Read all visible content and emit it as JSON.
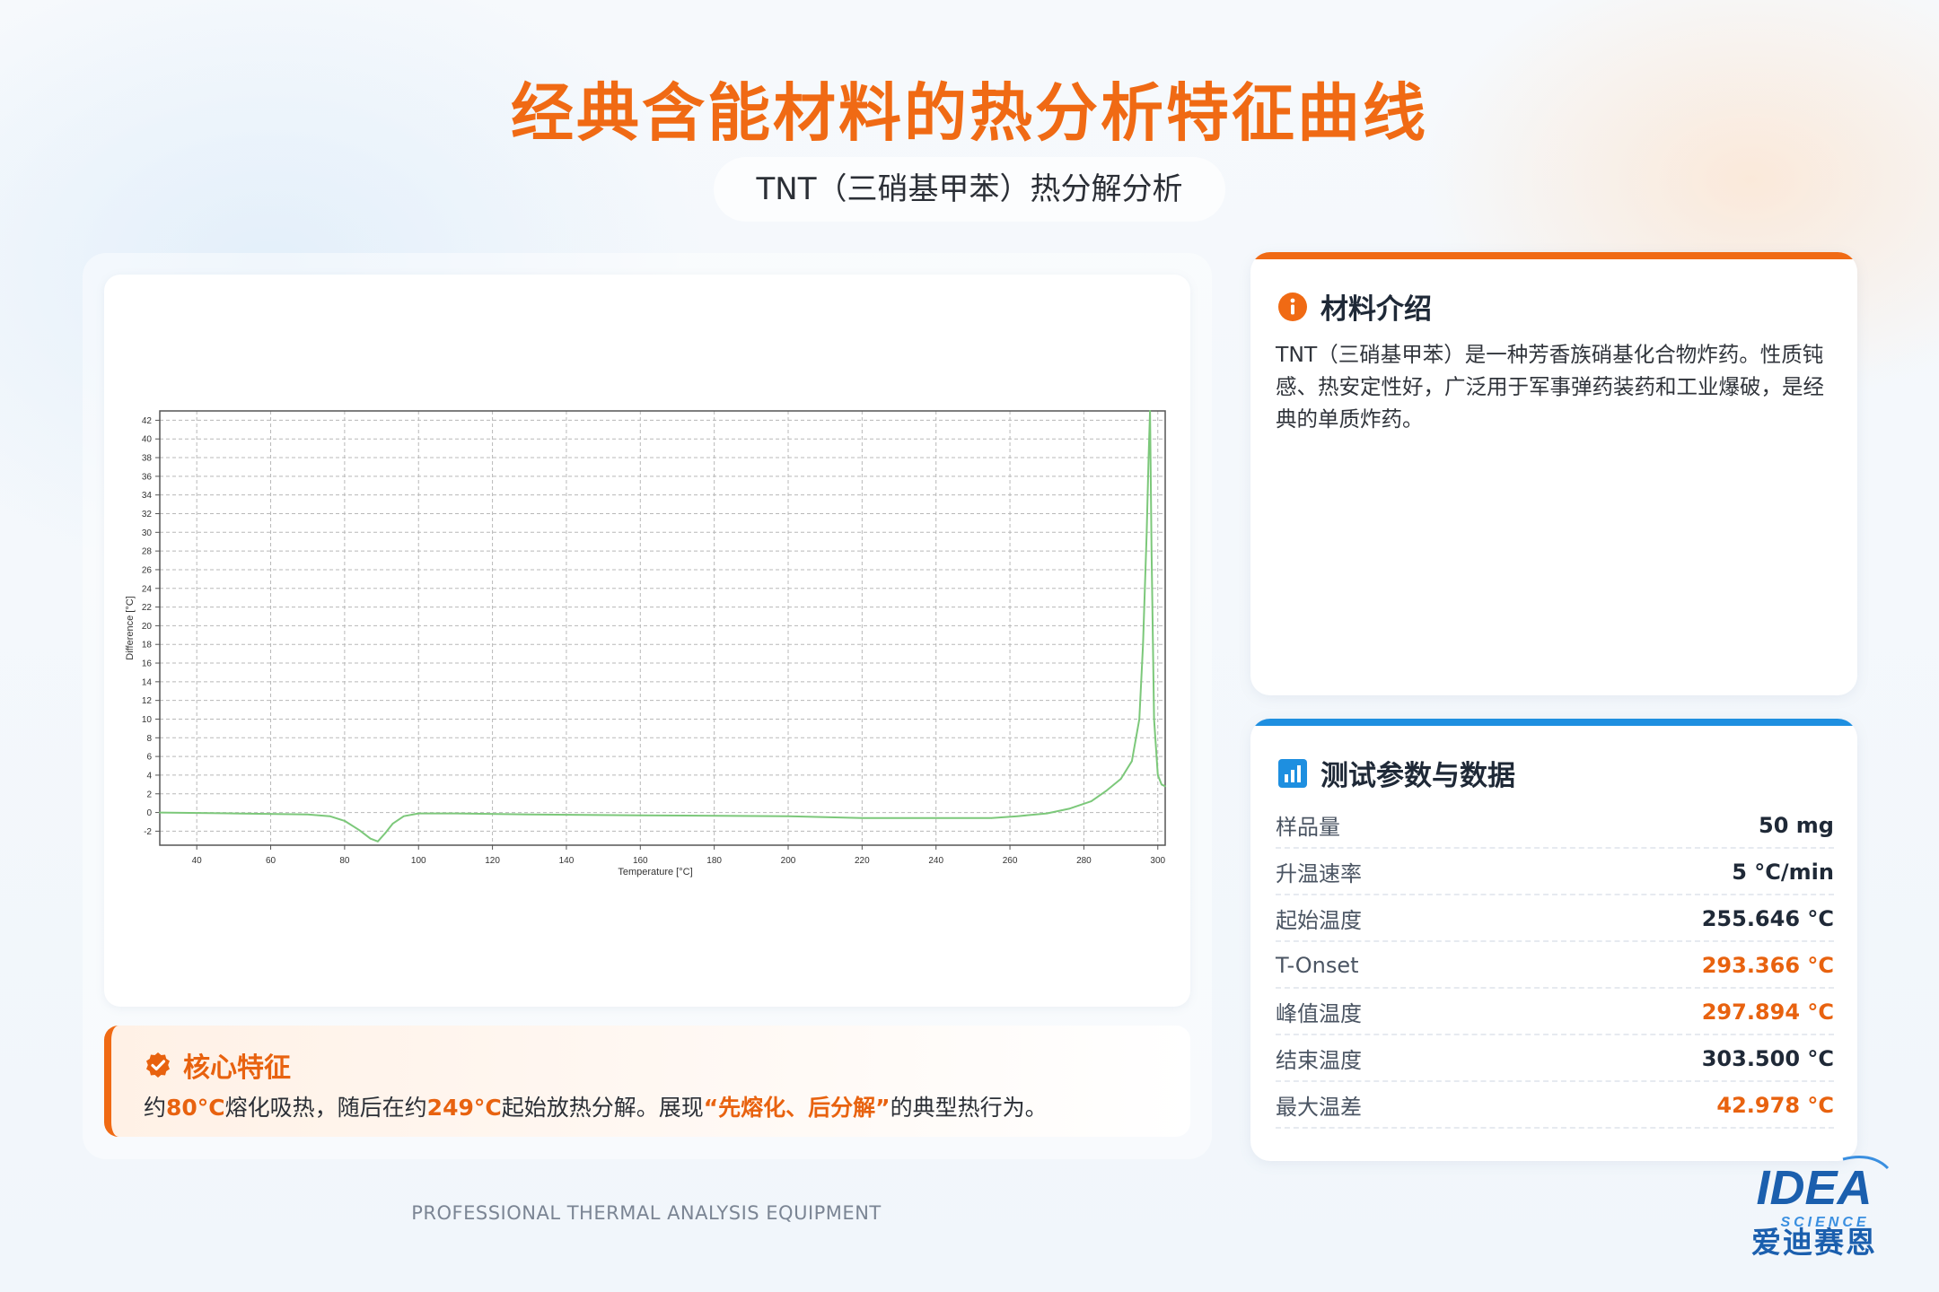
{
  "header": {
    "title": "经典含能材料的热分析特征曲线",
    "subtitle": "TNT（三硝基甲苯）热分解分析"
  },
  "chart_data": {
    "type": "line",
    "xlabel": "Temperature [°C]",
    "ylabel": "Difference [°C]",
    "xlim": [
      30,
      302
    ],
    "ylim": [
      -3.5,
      43
    ],
    "x_ticks": [
      40,
      60,
      80,
      100,
      120,
      140,
      160,
      180,
      200,
      220,
      240,
      260,
      280,
      300
    ],
    "y_ticks": [
      -2,
      0,
      2,
      4,
      6,
      8,
      10,
      12,
      14,
      16,
      18,
      20,
      22,
      24,
      26,
      28,
      30,
      32,
      34,
      36,
      38,
      40,
      42
    ],
    "grid": true,
    "color": "#7cc87a",
    "x": [
      30,
      50,
      70,
      76,
      80,
      84,
      87,
      89,
      91,
      93,
      96,
      100,
      110,
      130,
      160,
      200,
      220,
      240,
      255,
      262,
      270,
      276,
      282,
      286,
      290,
      293,
      295,
      296,
      297,
      297.5,
      297.9,
      298.3,
      299,
      300,
      301,
      302
    ],
    "y": [
      0.0,
      -0.1,
      -0.2,
      -0.4,
      -0.9,
      -1.9,
      -2.8,
      -3.1,
      -2.2,
      -1.2,
      -0.4,
      -0.1,
      -0.1,
      -0.2,
      -0.3,
      -0.4,
      -0.6,
      -0.6,
      -0.6,
      -0.4,
      -0.1,
      0.4,
      1.2,
      2.3,
      3.6,
      5.5,
      10.0,
      18.0,
      30.0,
      38.0,
      43.0,
      28.0,
      10.0,
      4.0,
      3.0,
      2.8
    ]
  },
  "feature": {
    "title": "核心特征",
    "t1": "约",
    "h1": "80°C",
    "t2": "熔化吸热，随后在约",
    "h2": "249°C",
    "t3": "起始放热分解。展现",
    "h3": "“先熔化、后分解”",
    "t4": "的典型热行为。"
  },
  "intro": {
    "title": "材料介绍",
    "text": "TNT（三硝基甲苯）是一种芳香族硝基化合物炸药。性质钝感、热安定性好，广泛用于军事弹药装药和工业爆破，是经典的单质炸药。"
  },
  "params": {
    "title": "测试参数与数据",
    "rows": [
      {
        "label": "样品量",
        "value": "50 mg",
        "accent": false
      },
      {
        "label": "升温速率",
        "value": "5 °C/min",
        "accent": false
      },
      {
        "label": "起始温度",
        "value": "255.646 °C",
        "accent": false
      },
      {
        "label": "T-Onset",
        "value": "293.366 °C",
        "accent": true
      },
      {
        "label": "峰值温度",
        "value": "297.894 °C",
        "accent": true
      },
      {
        "label": "结束温度",
        "value": "303.500 °C",
        "accent": false
      },
      {
        "label": "最大温差",
        "value": "42.978 °C",
        "accent": true
      }
    ]
  },
  "footer": {
    "text": "PROFESSIONAL THERMAL ANALYSIS EQUIPMENT"
  },
  "logo": {
    "text": "IDEA",
    "sub": "SCIENCE",
    "cn": "爱迪赛恩",
    "color": "#1b5fae"
  }
}
